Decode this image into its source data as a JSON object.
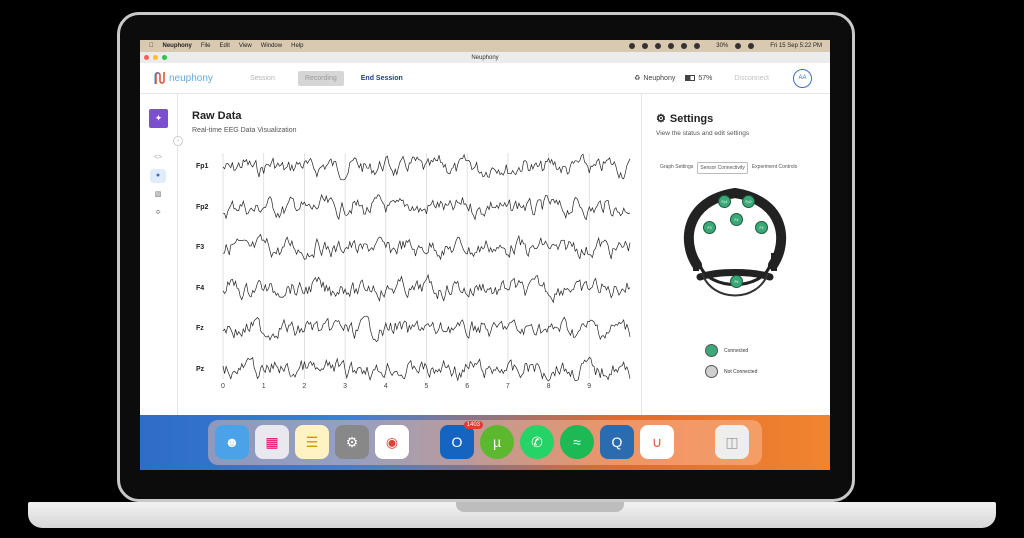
{
  "menubar": {
    "app": "Neuphony",
    "menus": [
      "File",
      "Edit",
      "View",
      "Window",
      "Help"
    ],
    "battery": "30%",
    "datetime": "Fri 15 Sep  5:22 PM"
  },
  "window": {
    "title": "Neuphony"
  },
  "topnav": {
    "logo_text": "neuphony",
    "session": "Session",
    "recording": "Recording",
    "end_session": "End Session",
    "device": "Neuphony",
    "battery": "57%",
    "disconnect": "Disconnect",
    "avatar": "AA"
  },
  "main": {
    "title": "Raw Data",
    "subtitle": "Real-time EEG Data Visualization"
  },
  "chart_data": {
    "type": "line",
    "channels": [
      "Fp1",
      "Fp2",
      "F3",
      "F4",
      "Fz",
      "Pz"
    ],
    "x_ticks": [
      0,
      1,
      2,
      3,
      4,
      5,
      6,
      7,
      8,
      9
    ],
    "xlim": [
      0,
      10
    ],
    "grid": "vertical"
  },
  "settings": {
    "title": "Settings",
    "subtitle": "View the status and edit settings",
    "tabs": [
      "Graph Settings",
      "Sensor Connectivity",
      "Experiment Controls"
    ],
    "active_tab": "Sensor Connectivity",
    "sensors": [
      "Fp1",
      "Fp2",
      "F3",
      "Fz",
      "F4",
      "Pz"
    ],
    "legend": {
      "connected": "Connected",
      "not_connected": "Not Connected"
    },
    "colors": {
      "connected": "#3aa877",
      "not_connected": "#cfcfcf"
    }
  },
  "dock": {
    "outlook_badge": "1403"
  }
}
